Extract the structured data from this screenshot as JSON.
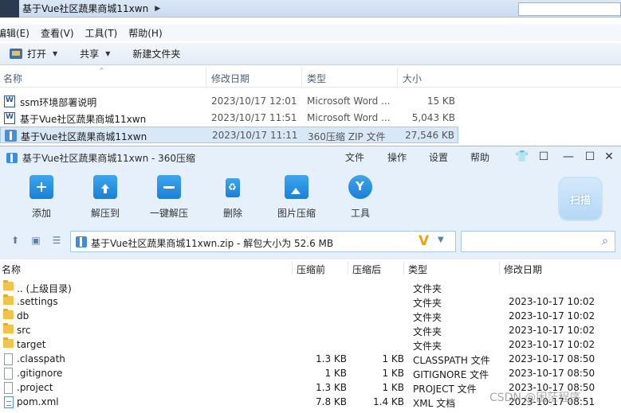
{
  "explorer": {
    "breadcrumb": "基于Vue社区蔬果商城11xwn",
    "menu": [
      "编辑(E)",
      "查看(V)",
      "工具(T)",
      "帮助(H)"
    ],
    "toolbar": {
      "open": "打开",
      "share": "共享",
      "new_folder": "新建文件夹"
    },
    "columns": {
      "name": "名称",
      "modified": "修改日期",
      "type": "类型",
      "size": "大小"
    },
    "files": [
      {
        "name": "ssm环境部署说明",
        "modified": "2023/10/17 12:01",
        "type": "Microsoft Word ...",
        "size": "15 KB",
        "icon": "word-icon",
        "selected": false
      },
      {
        "name": "基于Vue社区蔬果商城11xwn",
        "modified": "2023/10/17 11:51",
        "type": "Microsoft Word ...",
        "size": "5,043 KB",
        "icon": "word-icon",
        "selected": false
      },
      {
        "name": "基于Vue社区蔬果商城11xwn",
        "modified": "2023/10/17 11:11",
        "type": "360压缩 ZIP 文件",
        "size": "27,546 KB",
        "icon": "zip-icon",
        "selected": true
      }
    ]
  },
  "zip": {
    "title": "基于Vue社区蔬果商城11xwn - 360压缩",
    "menu": [
      "文件",
      "操作",
      "设置",
      "帮助"
    ],
    "tools": [
      "添加",
      "解压到",
      "一键解压",
      "删除",
      "图片压缩",
      "工具"
    ],
    "scan": "扫描",
    "path": "基于Vue社区蔬果商城11xwn.zip - 解包大小为 52.6 MB",
    "search_placeholder": "",
    "columns": {
      "name": "名称",
      "compressed": "压缩前",
      "after": "压缩后",
      "type": "类型",
      "modified": "修改日期"
    },
    "entries": [
      {
        "name": ".. (上级目录)",
        "before": "",
        "after": "",
        "type": "文件夹",
        "modified": "",
        "icon": "folder-icon"
      },
      {
        "name": ".settings",
        "before": "",
        "after": "",
        "type": "文件夹",
        "modified": "2023-10-17 10:02",
        "icon": "folder-icon"
      },
      {
        "name": "db",
        "before": "",
        "after": "",
        "type": "文件夹",
        "modified": "2023-10-17 10:02",
        "icon": "folder-icon"
      },
      {
        "name": "src",
        "before": "",
        "after": "",
        "type": "文件夹",
        "modified": "2023-10-17 10:02",
        "icon": "folder-icon"
      },
      {
        "name": "target",
        "before": "",
        "after": "",
        "type": "文件夹",
        "modified": "2023-10-17 10:02",
        "icon": "folder-icon"
      },
      {
        "name": ".classpath",
        "before": "1.3 KB",
        "after": "1 KB",
        "type": "CLASSPATH 文件",
        "modified": "2023-10-17 08:50",
        "icon": "file-icon"
      },
      {
        "name": ".gitignore",
        "before": "1 KB",
        "after": "1 KB",
        "type": "GITIGNORE 文件",
        "modified": "2023-10-17 08:50",
        "icon": "file-icon"
      },
      {
        "name": ".project",
        "before": "1.3 KB",
        "after": "1 KB",
        "type": "PROJECT 文件",
        "modified": "2023-10-17 08:50",
        "icon": "file-icon"
      },
      {
        "name": "pom.xml",
        "before": "7.8 KB",
        "after": "1.4 KB",
        "type": "XML 文档",
        "modified": "2023-10-17 08:51",
        "icon": "xml-icon"
      }
    ],
    "watermark": "CSDN @困茫程序"
  }
}
